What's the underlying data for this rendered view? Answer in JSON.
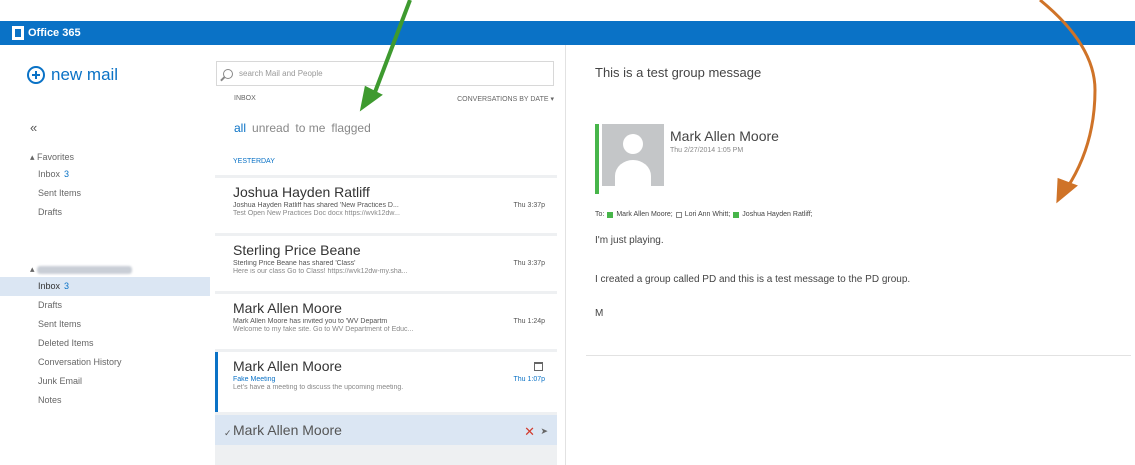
{
  "app": {
    "brand": "Office 365"
  },
  "leftnav": {
    "new_mail": "new mail",
    "collapse": "«",
    "favorites": {
      "header": "Favorites",
      "items": [
        {
          "label": "Inbox",
          "count": "3"
        },
        {
          "label": "Sent Items",
          "count": ""
        },
        {
          "label": "Drafts",
          "count": ""
        }
      ]
    },
    "account": {
      "items": [
        {
          "label": "Inbox",
          "count": "3"
        },
        {
          "label": "Drafts",
          "count": ""
        },
        {
          "label": "Sent Items",
          "count": ""
        },
        {
          "label": "Deleted Items",
          "count": ""
        },
        {
          "label": "Conversation History",
          "count": ""
        },
        {
          "label": "Junk Email",
          "count": ""
        },
        {
          "label": "Notes",
          "count": ""
        }
      ]
    }
  },
  "search": {
    "placeholder": "search Mail and People"
  },
  "list_header": {
    "folder": "INBOX",
    "sort": "CONVERSATIONS BY DATE"
  },
  "filters": [
    "all",
    "unread",
    "to me",
    "flagged"
  ],
  "day_label": "YESTERDAY",
  "messages": [
    {
      "from": "Joshua Hayden Ratliff",
      "summary": "Joshua Hayden Ratliff has shared 'New Practices D...",
      "time": "Thu 3:37p",
      "preview": "Test Open New Practices Doc docx https://wvk12dw..."
    },
    {
      "from": "Sterling Price Beane",
      "summary": "Sterling Price Beane has shared 'Class'",
      "time": "Thu 3:37p",
      "preview": "Here is our class Go to Class! https://wvk12dw-my.sha..."
    },
    {
      "from": "Mark Allen Moore",
      "summary": "Mark Allen Moore has invited you to 'WV Departm",
      "time": "Thu 1:24p",
      "preview": "Welcome to my fake site. Go to WV Department of Educ..."
    },
    {
      "from": "Mark Allen Moore",
      "summary": "Fake Meeting",
      "time": "Thu 1:07p",
      "preview": "Let's have a meeting to discuss the upcoming meeting."
    },
    {
      "from": "Mark Allen Moore"
    }
  ],
  "reading": {
    "subject": "This is a test group message",
    "sender": "Mark Allen Moore",
    "date": "Thu 2/27/2014 1:05 PM",
    "to_label": "To:",
    "recipients": [
      {
        "name": "Mark Allen Moore;",
        "status": "green"
      },
      {
        "name": "Lori Ann Whitt;",
        "status": "empty"
      },
      {
        "name": "Joshua Hayden Ratliff;",
        "status": "green"
      }
    ],
    "body": [
      "I'm just playing.",
      "I created a group called PD and this is a test message to the PD group.",
      "M"
    ]
  },
  "colors": {
    "brand_blue": "#0a72c6",
    "presence_green": "#47b54a",
    "arrow_green": "#3e9a2f",
    "arrow_orange": "#cf7328"
  }
}
